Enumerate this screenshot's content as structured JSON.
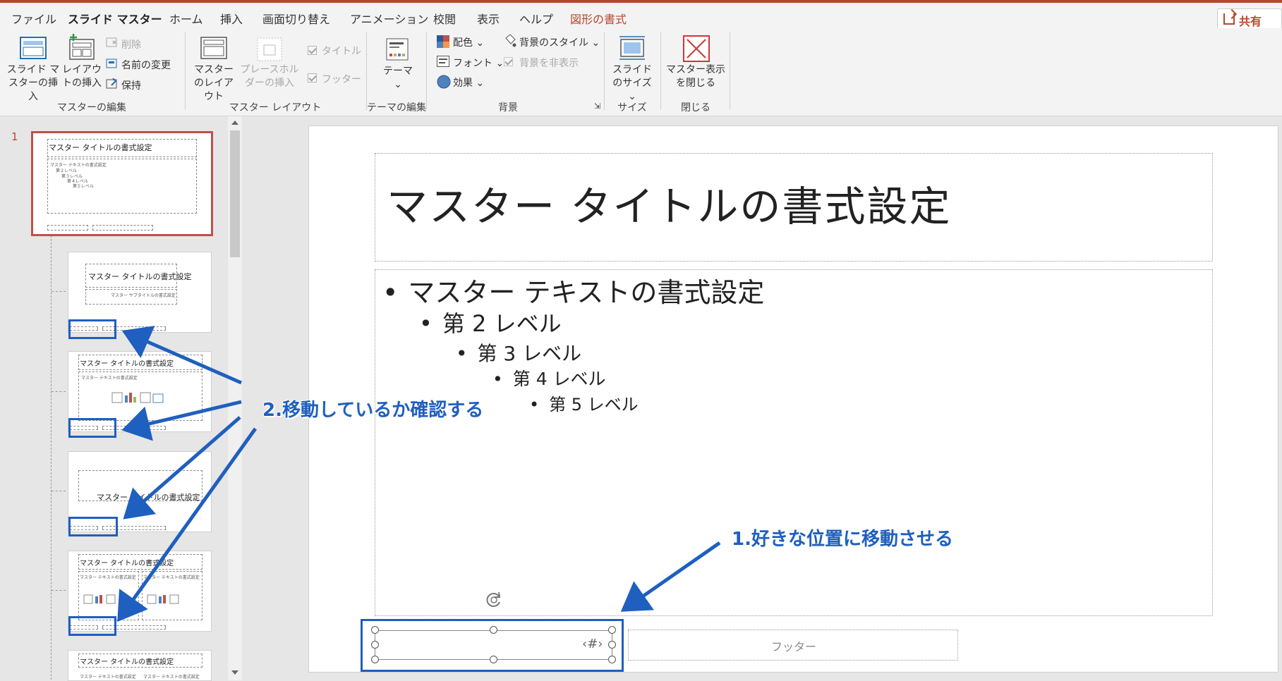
{
  "tabs": [
    "ファイル",
    "スライド マスター",
    "ホーム",
    "挿入",
    "画面切り替え",
    "アニメーション",
    "校閲",
    "表示",
    "ヘルプ",
    "図形の書式"
  ],
  "share_label": "共有",
  "ribbon": {
    "insert_master": "スライド マスターの挿入",
    "insert_layout": "レイアウトの挿入",
    "delete": "削除",
    "rename": "名前の変更",
    "preserve": "保持",
    "group_master_edit": "マスターの編集",
    "master_layout": "マスターのレイアウト",
    "insert_placeholder": "プレースホルダーの挿入",
    "title_check": "タイトル",
    "footer_check": "フッター",
    "group_master_layout": "マスター レイアウト",
    "theme": "テーマ",
    "group_theme_edit": "テーマの編集",
    "colors": "配色",
    "fonts": "フォント",
    "effects": "効果",
    "bg_styles": "背景のスタイル",
    "hide_bg": "背景を非表示",
    "group_background": "背景",
    "slide_size": "スライドのサイズ",
    "group_size": "サイズ",
    "close_master": "マスター表示を閉じる",
    "group_close": "閉じる"
  },
  "thumbnails": {
    "slide_number": "1",
    "master_title": "マスター タイトルの書式設定",
    "master_text": "マスター テキストの書式設定",
    "level2": "第２レベル",
    "level3": "第３レベル",
    "level4": "第４レベル",
    "level5": "第５レベル",
    "layout2_title": "マスター タイトルの書式設定",
    "layout2_sub": "マスター サブタイトルの書式設定",
    "layout3_title": "マスター タイトルの書式設定",
    "layout4_title": "マスター タイトルの書式設定",
    "layout5_title": "マスター タイトルの書式設定",
    "layout6_title": "マスター タイトルの書式設定"
  },
  "slide": {
    "title": "マスター タイトルの書式設定",
    "level1": "マスター テキストの書式設定",
    "level2": "第 2 レベル",
    "level3": "第 3 レベル",
    "level4": "第 4 レベル",
    "level5": "第 5 レベル",
    "footer": "フッター",
    "slide_number": "‹#›"
  },
  "annotations": {
    "step1": "1.好きな位置に移動させる",
    "step2": "2.移動しているか確認する"
  },
  "colors": {
    "accent": "#b7472a",
    "annotation_blue": "#1f5fbf"
  }
}
